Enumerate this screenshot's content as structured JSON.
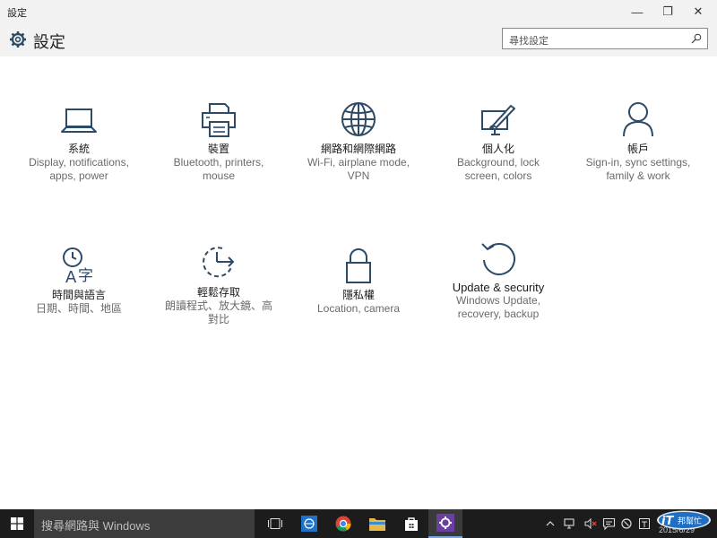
{
  "window": {
    "title": "設定",
    "controls": {
      "minimize": "—",
      "maximize": "❐",
      "close": "✕"
    }
  },
  "header": {
    "title": "設定",
    "search_placeholder": "尋找設定"
  },
  "tiles": [
    {
      "icon": "laptop-icon",
      "name": "系統",
      "desc1": "Display, notifications,",
      "desc2": "apps, power"
    },
    {
      "icon": "printer-icon",
      "name": "裝置",
      "desc1": "Bluetooth, printers,",
      "desc2": "mouse"
    },
    {
      "icon": "globe-icon",
      "name": "網路和網際網路",
      "desc1": "Wi-Fi, airplane mode,",
      "desc2": "VPN"
    },
    {
      "icon": "paint-screen-icon",
      "name": "個人化",
      "desc1": "Background, lock",
      "desc2": "screen, colors"
    },
    {
      "icon": "person-icon",
      "name": "帳戶",
      "desc1": "Sign-in, sync settings,",
      "desc2": "family & work"
    },
    {
      "icon": "time-language-icon",
      "name": "時間與語言",
      "desc1": "日期、時間、地區",
      "desc2": ""
    },
    {
      "icon": "ease-of-access-icon",
      "name": "輕鬆存取",
      "desc1": "朗讀程式、放大鏡、高",
      "desc2": "對比"
    },
    {
      "icon": "lock-icon",
      "name": "隱私權",
      "desc1": "Location, camera",
      "desc2": ""
    },
    {
      "icon": "update-icon",
      "name": "Update & security",
      "desc1": "Windows Update,",
      "desc2": "recovery, backup"
    }
  ],
  "taskbar": {
    "search_placeholder": "搜尋網路與 Windows",
    "clock": "2015/6/29",
    "watermark_text": "iT邦幫忙"
  },
  "colors": {
    "icon_stroke": "#2d4a66",
    "titlebar_bg": "#f2f2f2",
    "taskbar_bg": "#1c1c1c",
    "settings_taskbar_icon": "#6b3fa0"
  }
}
